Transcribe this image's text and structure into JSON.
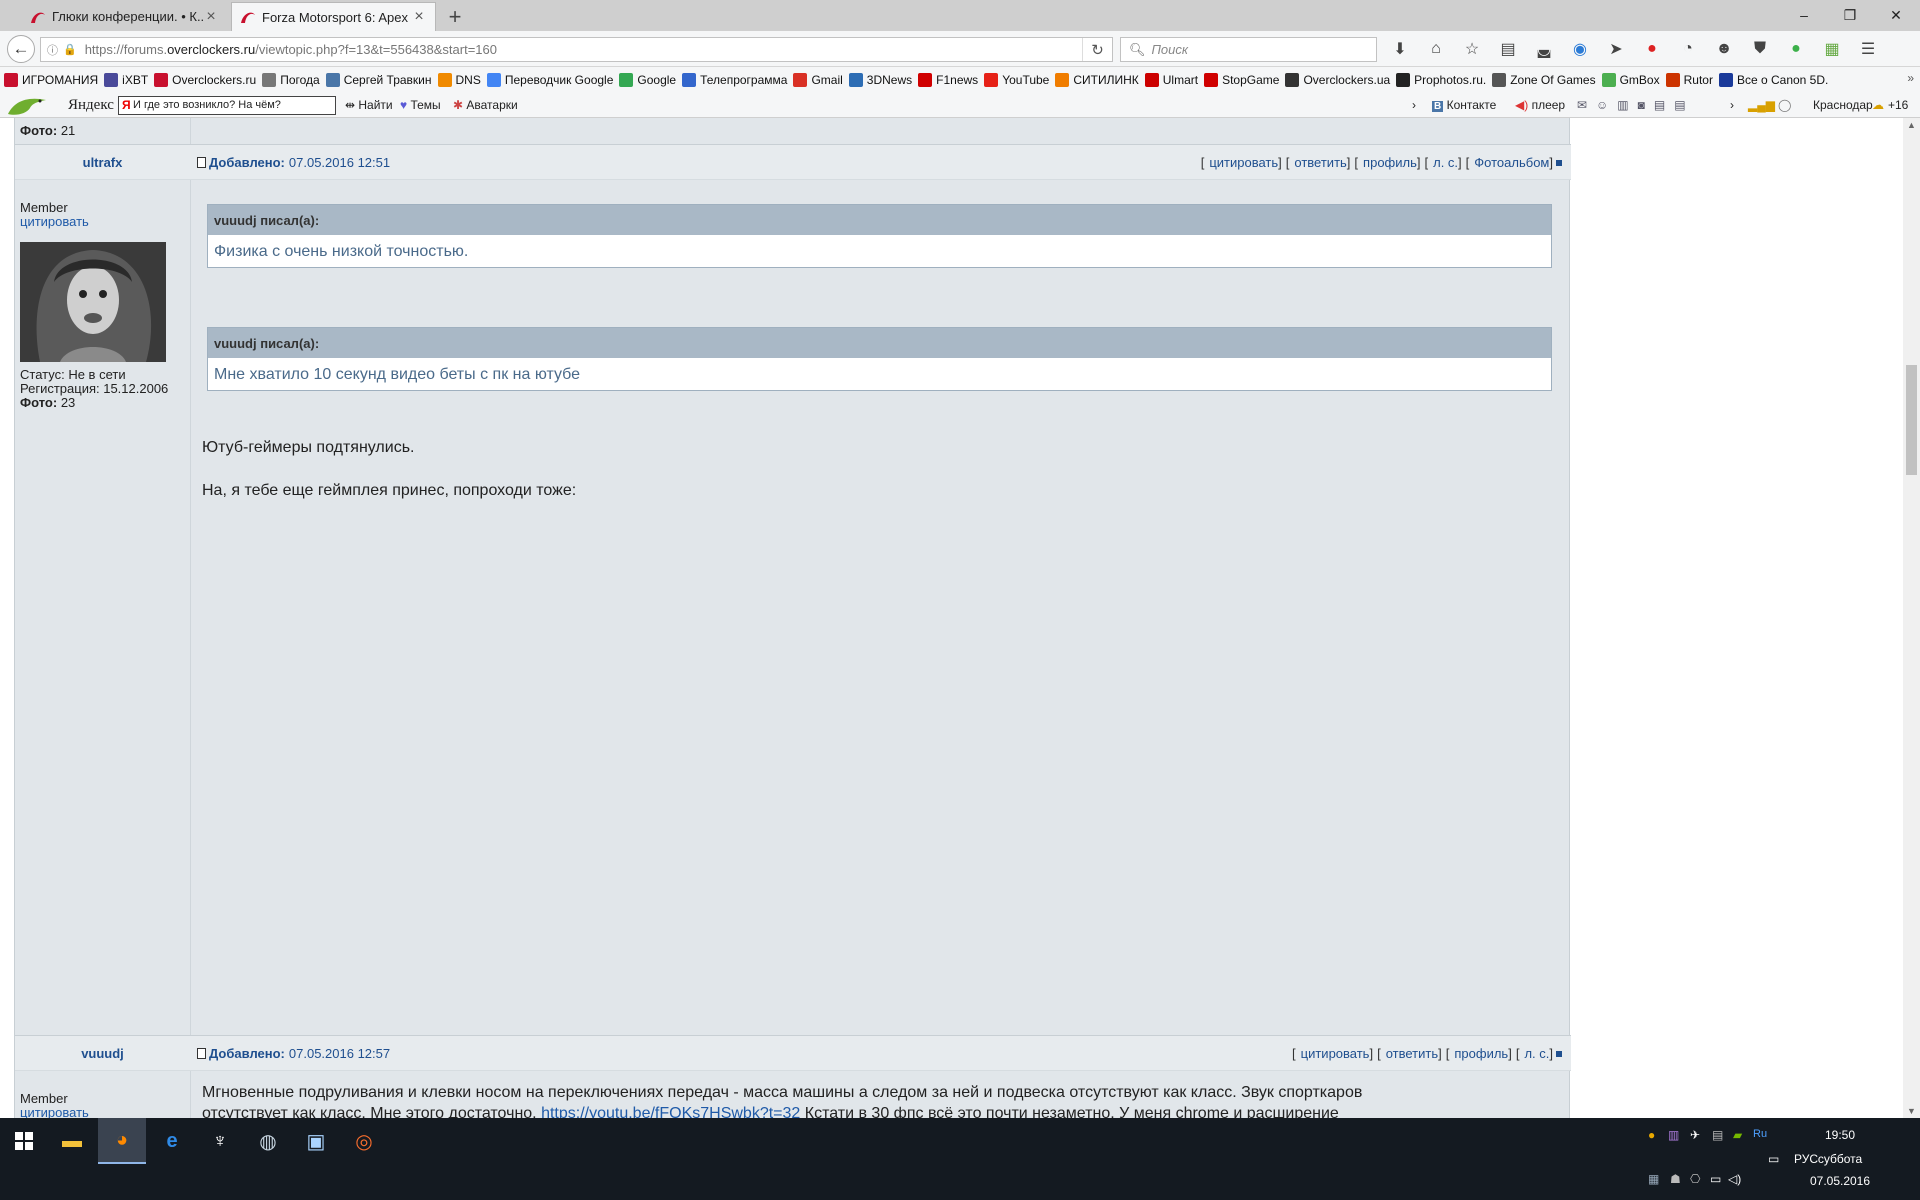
{
  "browser": {
    "tabs": [
      {
        "title": "Глюки конференции. • К...",
        "active": false
      },
      {
        "title": "Forza Motorsport 6: Apex ...",
        "active": true
      }
    ],
    "url_prefix": "https://forums.",
    "url_host": "overclockers.ru",
    "url_path": "/viewtopic.php?f=13&t=556438&start=160",
    "search_placeholder": "Поиск",
    "window_controls": [
      "–",
      "❐",
      "✕"
    ]
  },
  "bookmarks": [
    {
      "label": "ИГРОМАНИЯ",
      "color": "#c8102e"
    },
    {
      "label": "iXBT",
      "color": "#4a4a9a"
    },
    {
      "label": "Overclockers.ru",
      "color": "#c8102e"
    },
    {
      "label": "Погода",
      "color": "#777777"
    },
    {
      "label": "Сергей Травкин",
      "color": "#4a76a8"
    },
    {
      "label": "DNS",
      "color": "#f08a00"
    },
    {
      "label": "Переводчик Google",
      "color": "#4285f4"
    },
    {
      "label": "Google",
      "color": "#34a853"
    },
    {
      "label": "Телепрограмма",
      "color": "#3366cc"
    },
    {
      "label": "Gmail",
      "color": "#d93025"
    },
    {
      "label": "3DNews",
      "color": "#2d6db4"
    },
    {
      "label": "F1news",
      "color": "#d00000"
    },
    {
      "label": "YouTube",
      "color": "#e62117"
    },
    {
      "label": "СИТИЛИНК",
      "color": "#f07d00"
    },
    {
      "label": "Ulmart",
      "color": "#cc0000"
    },
    {
      "label": "StopGame",
      "color": "#d00000"
    },
    {
      "label": "Overclockers.ua",
      "color": "#333333"
    },
    {
      "label": "Prophotos.ru.",
      "color": "#222222"
    },
    {
      "label": "Zone Of Games",
      "color": "#555555"
    },
    {
      "label": "GmBox",
      "color": "#4caf50"
    },
    {
      "label": "Rutor",
      "color": "#cc3300"
    },
    {
      "label": "Все о Canon 5D.",
      "color": "#1a3a9a"
    }
  ],
  "yabar": {
    "brand": "Яндекс",
    "query": "И где это возникло? На чём?",
    "find": "Найти",
    "themes": "Темы",
    "avatars": "Аватарки",
    "vk": "Контакте",
    "player": "плеер",
    "city": "Краснодар",
    "temp": "+16"
  },
  "top_post_tail": {
    "photos_label": "Фото:",
    "photos_value": "21"
  },
  "post1": {
    "author": "ultrafx",
    "posted_label": "Добавлено:",
    "posted_at": "07.05.2016 12:51",
    "actions": [
      "цитировать",
      "ответить",
      "профиль",
      "л. с.",
      "Фотоальбом"
    ],
    "rank": "Member",
    "quote_link": "цитировать",
    "status": "Статус: Не в сети",
    "registered": "Регистрация: 15.12.2006",
    "photos_label": "Фото:",
    "photos_value": "23",
    "quotes": [
      {
        "header": "vuuudj писал(а):",
        "body": "Физика с очень низкой точностью."
      },
      {
        "header": "vuuudj писал(а):",
        "body": "Мне хватило 10 секунд видео беты с пк на ютубе"
      }
    ],
    "lines": [
      "Ютуб-геймеры подтянулись.",
      "На, я тебе еще геймплея принес, попроходи тоже:"
    ]
  },
  "post2": {
    "author": "vuuudj",
    "posted_label": "Добавлено:",
    "posted_at": "07.05.2016 12:57",
    "actions": [
      "цитировать",
      "ответить",
      "профиль",
      "л. с."
    ],
    "rank": "Member",
    "quote_link": "цитировать",
    "line1": "Мгновенные подруливания и клевки носом на переключениях передач - масса машины а следом за ней и подвеска отсутствуют как класс. Звук спорткаров",
    "line2_a": "отсутствует как класс. Мне этого достаточно. ",
    "line2_link": "https://youtu.be/fFOKs7HSwbk?t=32",
    "line2_b": " Кстати в 30 фпс всё это почти незаметно. У меня chrome и расширение"
  },
  "taskbar": {
    "lang": "РУС",
    "time": "19:50",
    "day": "суббота",
    "date": "07.05.2016"
  }
}
